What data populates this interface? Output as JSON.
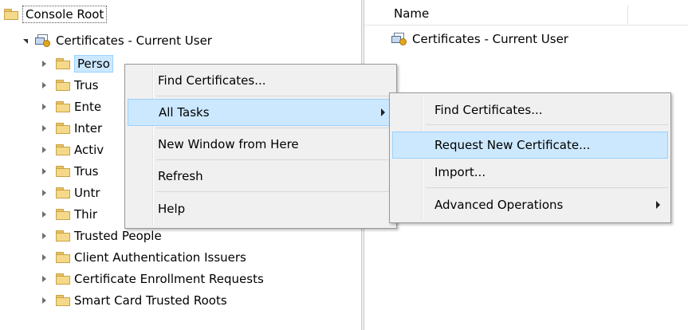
{
  "tree": {
    "root_label": "Console Root",
    "store_label": "Certificates - Current User",
    "items": [
      "Personal",
      "Trusted Root Certification Authorities",
      "Enterprise Trust",
      "Intermediate Certification Authorities",
      "Active Directory User Object",
      "Trusted Publishers",
      "Untrusted Certificates",
      "Third-Party Root Certification Authorities",
      "Trusted People",
      "Client Authentication Issuers",
      "Certificate Enrollment Requests",
      "Smart Card Trusted Roots"
    ],
    "visible_items": [
      "Perso",
      "Trus",
      "Ente",
      "Inter",
      "Activ",
      "Trus",
      "Untr",
      "Thir"
    ]
  },
  "list": {
    "column_name": "Name",
    "items": [
      "Certificates - Current User"
    ]
  },
  "context_menu": {
    "items": [
      {
        "label": "Find Certificates...",
        "submenu": false
      },
      {
        "label": "All Tasks",
        "submenu": true,
        "highlighted": true
      },
      {
        "label": "New Window from Here",
        "submenu": false
      },
      {
        "label": "Refresh",
        "submenu": false
      },
      {
        "label": "Help",
        "submenu": false
      }
    ]
  },
  "submenu": {
    "items": [
      {
        "label": "Find Certificates...",
        "submenu": false
      },
      {
        "label": "Request New Certificate...",
        "submenu": false,
        "highlighted": true
      },
      {
        "label": "Import...",
        "submenu": false
      },
      {
        "label": "Advanced Operations",
        "submenu": true
      }
    ]
  },
  "colors": {
    "highlight_bg": "#cce8ff",
    "highlight_border": "#99d1ff",
    "menu_bg": "#f0f0f0",
    "folder": "#f5d98a"
  },
  "icons": {
    "folder": "folder-icon",
    "store": "certificate-store-icon",
    "expand": "expand-triangle-icon",
    "collapse": "collapse-triangle-icon",
    "submenu": "submenu-arrow-icon"
  }
}
